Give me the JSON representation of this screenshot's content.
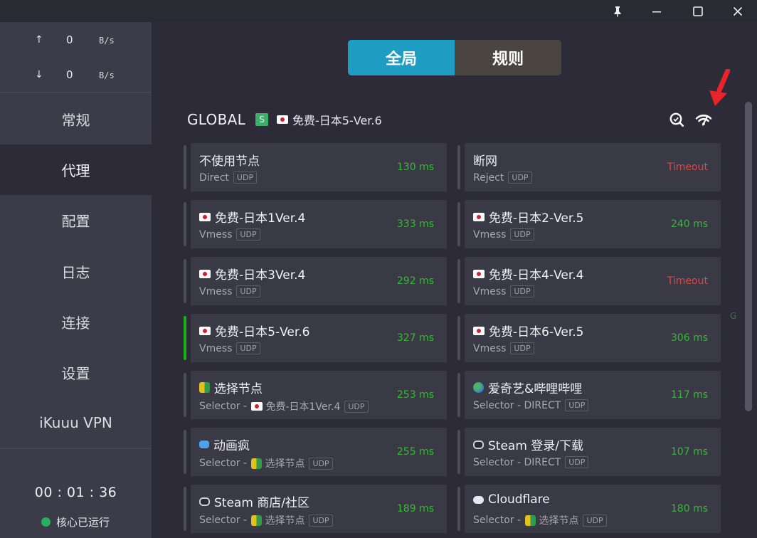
{
  "titlebar": {
    "pin_icon": "pin-icon",
    "minimize_icon": "minimize-icon",
    "maximize_icon": "maximize-icon",
    "close_icon": "close-icon"
  },
  "traffic": {
    "up_arrow": "↑",
    "up_value": "0",
    "up_unit": "B/s",
    "down_arrow": "↓",
    "down_value": "0",
    "down_unit": "B/s"
  },
  "nav": {
    "items": [
      {
        "label": "常规"
      },
      {
        "label": "代理"
      },
      {
        "label": "配置"
      },
      {
        "label": "日志"
      },
      {
        "label": "连接"
      },
      {
        "label": "设置"
      },
      {
        "label": "iKuuu VPN"
      }
    ],
    "active": "代理"
  },
  "status": {
    "clock": "00 : 01 : 36",
    "core_label": "核心已运行",
    "core_color": "#27ae60"
  },
  "mode": {
    "global_label": "全局",
    "rule_label": "规则",
    "selected": "全局",
    "accent": "#1e9cc2"
  },
  "group": {
    "name": "GLOBAL",
    "type_badge": "S",
    "selected_proxy": "免费-日本5-Ver.6",
    "search_icon": "latency-search-icon",
    "speedtest_icon": "wifi-speedtest-icon"
  },
  "proxies": [
    {
      "name": "不使用节点",
      "type": "Direct",
      "udp": "UDP",
      "latency": "130 ms",
      "status": "ok",
      "flag": ""
    },
    {
      "name": "断网",
      "type": "Reject",
      "udp": "UDP",
      "latency": "Timeout",
      "status": "bad",
      "flag": ""
    },
    {
      "name": "免费-日本1Ver.4",
      "type": "Vmess",
      "udp": "UDP",
      "latency": "333 ms",
      "status": "ok",
      "flag": "jp"
    },
    {
      "name": "免费-日本2-Ver.5",
      "type": "Vmess",
      "udp": "UDP",
      "latency": "240 ms",
      "status": "ok",
      "flag": "jp"
    },
    {
      "name": "免费-日本3Ver.4",
      "type": "Vmess",
      "udp": "UDP",
      "latency": "292 ms",
      "status": "ok",
      "flag": "jp"
    },
    {
      "name": "免费-日本4-Ver.4",
      "type": "Vmess",
      "udp": "UDP",
      "latency": "Timeout",
      "status": "bad",
      "flag": "jp"
    },
    {
      "name": "免费-日本5-Ver.6",
      "type": "Vmess",
      "udp": "UDP",
      "latency": "327 ms",
      "status": "ok",
      "flag": "jp",
      "selected": true
    },
    {
      "name": "免费-日本6-Ver.5",
      "type": "Vmess",
      "udp": "UDP",
      "latency": "306 ms",
      "status": "ok",
      "flag": "jp"
    },
    {
      "name": "选择节点",
      "type": "Selector - ",
      "via": "免费-日本1Ver.4",
      "udp": "UDP",
      "latency": "253 ms",
      "status": "ok",
      "flag": "beginner",
      "via_flag": "jp"
    },
    {
      "name": "爱奇艺&哔哩哔哩",
      "type": "Selector - DIRECT",
      "udp": "UDP",
      "latency": "117 ms",
      "status": "ok",
      "flag": "globe"
    },
    {
      "name": "动画疯",
      "type": "Selector - ",
      "via": "选择节点",
      "udp": "UDP",
      "latency": "255 ms",
      "status": "ok",
      "flag": "blue",
      "via_flag": "beginner"
    },
    {
      "name": "Steam 登录/下载",
      "type": "Selector - DIRECT",
      "udp": "UDP",
      "latency": "107 ms",
      "status": "ok",
      "flag": "gamepad"
    },
    {
      "name": "Steam 商店/社区",
      "type": "Selector - ",
      "via": "选择节点",
      "udp": "UDP",
      "latency": "189 ms",
      "status": "ok",
      "flag": "gamepad",
      "via_flag": "beginner"
    },
    {
      "name": "Cloudflare",
      "type": "Selector - ",
      "via": "选择节点",
      "udp": "UDP",
      "latency": "180 ms",
      "status": "ok",
      "flag": "cloud",
      "via_flag": "beginner"
    }
  ],
  "colors": {
    "latency_ok": "#34b934",
    "latency_bad": "#e34545",
    "selected_bar": "#17b417",
    "annotation_arrow": "#e8232a"
  },
  "stray_label": "G"
}
